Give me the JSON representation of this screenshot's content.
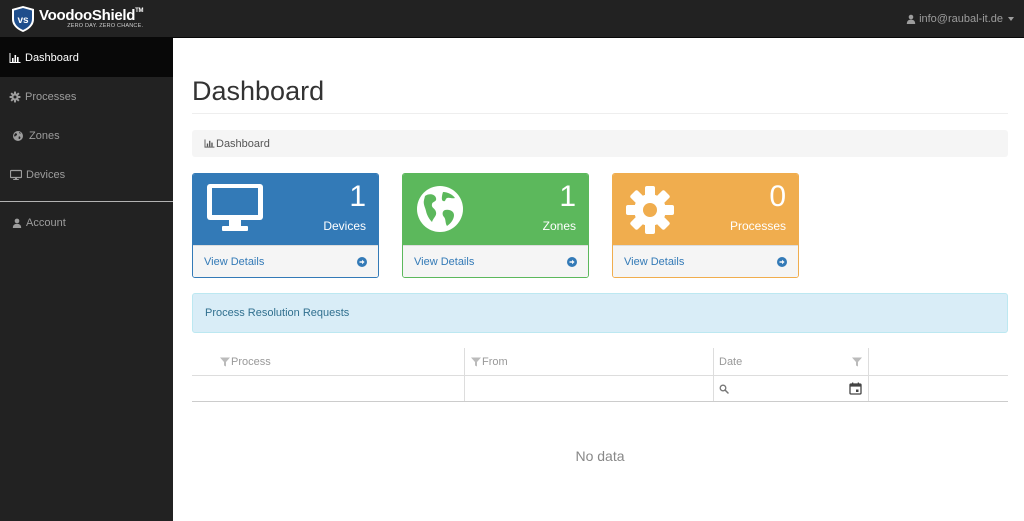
{
  "app": {
    "brand_name": "VoodooShield",
    "brand_tm": "TM",
    "brand_tagline": "ZERO DAY. ZERO CHANCE."
  },
  "topbar": {
    "user_email": "info@raubal-it.de"
  },
  "sidebar": {
    "items": [
      {
        "label": "Dashboard",
        "icon": "bar-chart-icon",
        "active": true
      },
      {
        "label": "Processes",
        "icon": "gear-icon",
        "active": false
      },
      {
        "label": "Zones",
        "icon": "globe-icon",
        "active": false
      },
      {
        "label": "Devices",
        "icon": "monitor-icon",
        "active": false
      }
    ],
    "account_label": "Account"
  },
  "page": {
    "title": "Dashboard",
    "breadcrumb": "Dashboard"
  },
  "panels": [
    {
      "count": "1",
      "label": "Devices",
      "link": "View Details",
      "icon": "monitor-icon",
      "color": "#337ab7"
    },
    {
      "count": "1",
      "label": "Zones",
      "link": "View Details",
      "icon": "globe-icon",
      "color": "#5cb85c"
    },
    {
      "count": "0",
      "label": "Processes",
      "link": "View Details",
      "icon": "gear-icon",
      "color": "#f0ad4e"
    }
  ],
  "requests": {
    "heading": "Process Resolution Requests",
    "columns": [
      "Process",
      "From",
      "Date"
    ],
    "empty_text": "No data"
  }
}
